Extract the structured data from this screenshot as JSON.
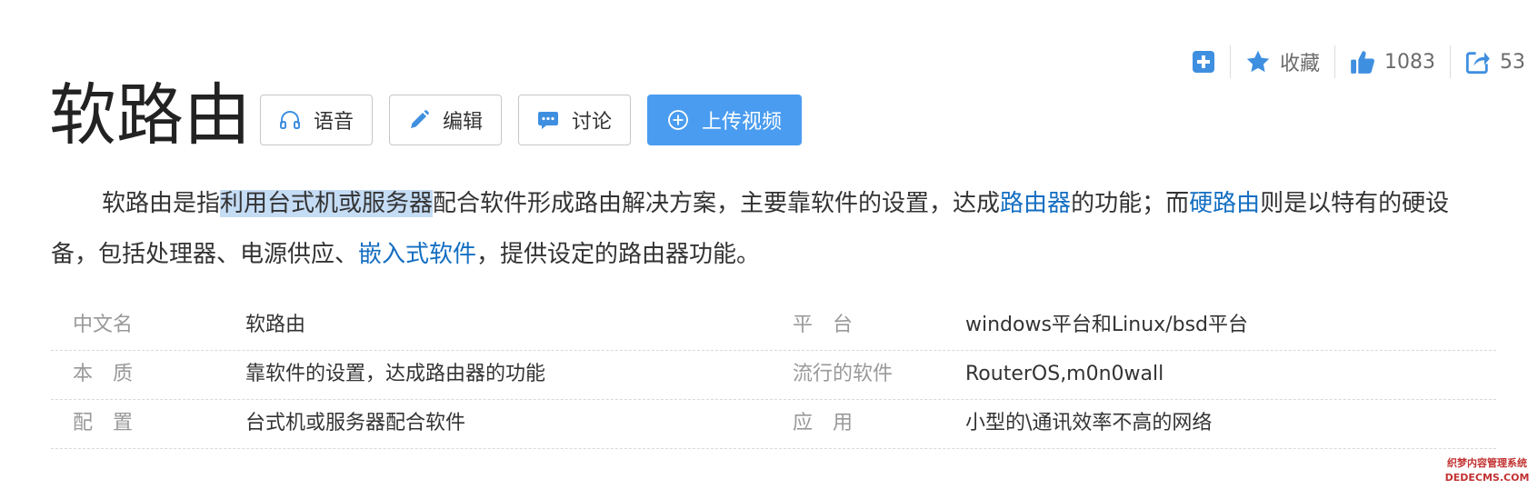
{
  "actions": {
    "collect_label": "收藏",
    "like_count": "1083",
    "share_count": "53"
  },
  "title": "软路由",
  "buttons": {
    "voice": "语音",
    "edit": "编辑",
    "discuss": "讨论",
    "upload": "上传视频"
  },
  "summary": {
    "seg1": "软路由是指",
    "seg2_highlight": "利用台式机或服务器",
    "seg3": "配合软件形成路由解决方案，主要靠软件的设置，达成",
    "link1": "路由器",
    "seg4": "的功能；而",
    "link2": "硬路由",
    "seg5": "则是以特有的硬设备，包括处理器、电源供应、",
    "link3": "嵌入式软件",
    "seg6": "，提供设定的路由器功能。"
  },
  "info": {
    "rows": [
      {
        "l1": "中文名",
        "v1": "软路由",
        "l2": "平　台",
        "v2": "windows平台和Linux/bsd平台"
      },
      {
        "l1": "本　质",
        "v1": "靠软件的设置，达成路由器的功能",
        "l2": "流行的软件",
        "v2": "RouterOS,m0n0wall"
      },
      {
        "l1": "配　置",
        "v1": "台式机或服务器配合软件",
        "l2": "应　用",
        "v2": "小型的\\通讯效率不高的网络"
      }
    ]
  },
  "watermark": {
    "line1": "织梦内容管理系统",
    "line2": "DEDECMS.COM"
  },
  "colors": {
    "link": "#136ec2",
    "primary_button": "#4a9cf0",
    "icon_blue": "#3f8fe0",
    "highlight": "#c5dcf5"
  }
}
